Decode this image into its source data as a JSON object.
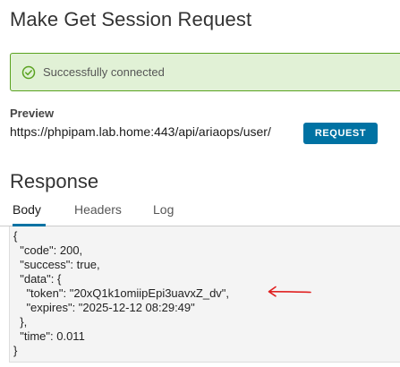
{
  "page": {
    "title": "Make Get Session Request"
  },
  "alert": {
    "icon": "check-circle-icon",
    "text": "Successfully connected",
    "colors": {
      "background": "#e1f1d6",
      "border": "#5aa220",
      "icon": "#5aa220"
    }
  },
  "preview": {
    "label": "Preview",
    "url": "https://phpipam.lab.home:443/api/ariaops/user/",
    "request_button": "REQUEST"
  },
  "response": {
    "title": "Response",
    "tabs": [
      {
        "label": "Body",
        "active": true
      },
      {
        "label": "Headers",
        "active": false
      },
      {
        "label": "Log",
        "active": false
      }
    ],
    "body_lines": [
      "{",
      "  \"code\": 200,",
      "  \"success\": true,",
      "  \"data\": {",
      "    \"token\": \"20xQ1k1omiipEpi3uavxZ_dv\",",
      "    \"expires\": \"2025-12-12 08:29:49\"",
      "  },",
      "  \"time\": 0.011",
      "}"
    ]
  },
  "annotation": {
    "icon": "red-arrow-icon",
    "color": "#e02020"
  },
  "colors": {
    "accent": "#0072a3"
  }
}
